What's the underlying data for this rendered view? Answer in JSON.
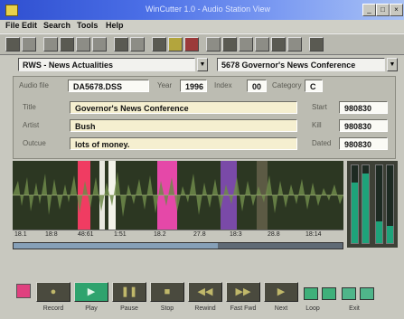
{
  "window": {
    "title": "WinCutter 1.0 - Audio Station View"
  },
  "menu": [
    "File",
    "Edit",
    "Search",
    "Tools",
    "Help"
  ],
  "selectors": {
    "category": "RWS - News Actualities",
    "cart": "5678 Governor's News Conference"
  },
  "info": {
    "audio_file_label": "Audio file",
    "audio_file": "DA5678.DSS",
    "year_label": "Year",
    "year": "1996",
    "index_label": "Index",
    "index": "00",
    "category_label": "Category",
    "category_code": "C",
    "title_label": "Title",
    "title": "Governor's News Conference",
    "artist_label": "Artist",
    "artist": "Bush",
    "outcue_label": "Outcue",
    "outcue": "lots of money.",
    "start_label": "Start",
    "start": "980830",
    "kill_label": "Kill",
    "kill": "980830",
    "dated_label": "Dated",
    "dated": "980830"
  },
  "markers": [
    "18.1",
    "18:8",
    "48:61",
    "1:51",
    "18.2",
    "27.8",
    "18:3",
    "28.8",
    "18:14"
  ],
  "position": 0.62,
  "meters": [
    0.78,
    0.9,
    0.28,
    0.22
  ],
  "transport": {
    "labels": [
      "Record",
      "Play",
      "Pause",
      "Stop",
      "Rewind",
      "Fast Fwd",
      "Next",
      "Loop",
      "Exit"
    ]
  }
}
